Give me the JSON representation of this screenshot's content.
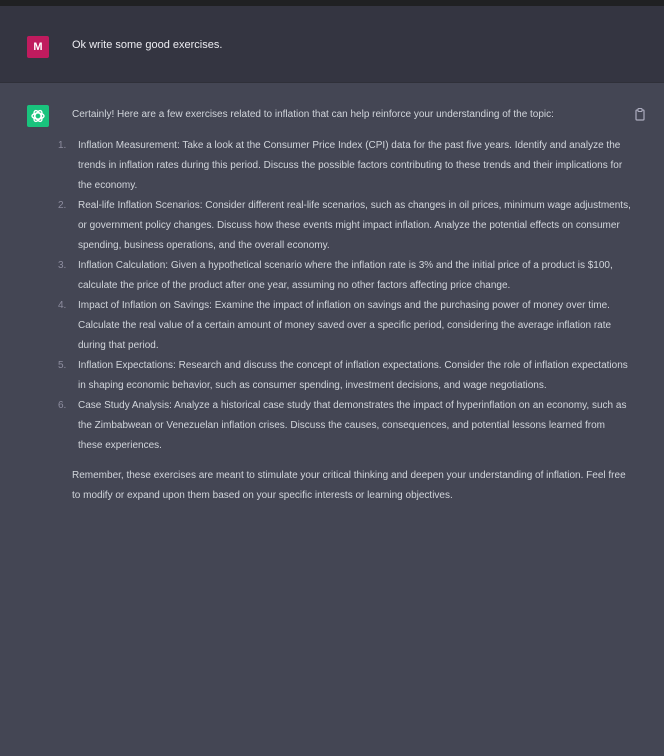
{
  "user_message": {
    "avatar_letter": "M",
    "text": "Ok write some good exercises."
  },
  "assistant_message": {
    "intro": "Certainly! Here are a few exercises related to inflation that can help reinforce your understanding of the topic:",
    "exercises": [
      {
        "number": "1.",
        "text": "Inflation Measurement: Take a look at the Consumer Price Index (CPI) data for the past five years. Identify and analyze the trends in inflation rates during this period. Discuss the possible factors contributing to these trends and their implications for the economy."
      },
      {
        "number": "2.",
        "text": "Real-life Inflation Scenarios: Consider different real-life scenarios, such as changes in oil prices, minimum wage adjustments, or government policy changes. Discuss how these events might impact inflation. Analyze the potential effects on consumer spending, business operations, and the overall economy."
      },
      {
        "number": "3.",
        "text": "Inflation Calculation: Given a hypothetical scenario where the inflation rate is 3% and the initial price of a product is $100, calculate the price of the product after one year, assuming no other factors affecting price change."
      },
      {
        "number": "4.",
        "text": "Impact of Inflation on Savings: Examine the impact of inflation on savings and the purchasing power of money over time. Calculate the real value of a certain amount of money saved over a specific period, considering the average inflation rate during that period."
      },
      {
        "number": "5.",
        "text": "Inflation Expectations: Research and discuss the concept of inflation expectations. Consider the role of inflation expectations in shaping economic behavior, such as consumer spending, investment decisions, and wage negotiations."
      },
      {
        "number": "6.",
        "text": "Case Study Analysis: Analyze a historical case study that demonstrates the impact of hyperinflation on an economy, such as the Zimbabwean or Venezuelan inflation crises. Discuss the causes, consequences, and potential lessons learned from these experiences."
      }
    ],
    "closing": "Remember, these exercises are meant to stimulate your critical thinking and deepen your understanding of inflation. Feel free to modify or expand upon them based on your specific interests or learning objectives."
  },
  "icons": {
    "assistant_avatar": "openai-logo-icon",
    "copy": "clipboard-copy-icon"
  },
  "colors": {
    "user_avatar_bg": "#c01b5e",
    "assistant_avatar_bg": "#19c37d",
    "assistant_row_bg": "#444654",
    "user_row_bg": "#343541"
  }
}
